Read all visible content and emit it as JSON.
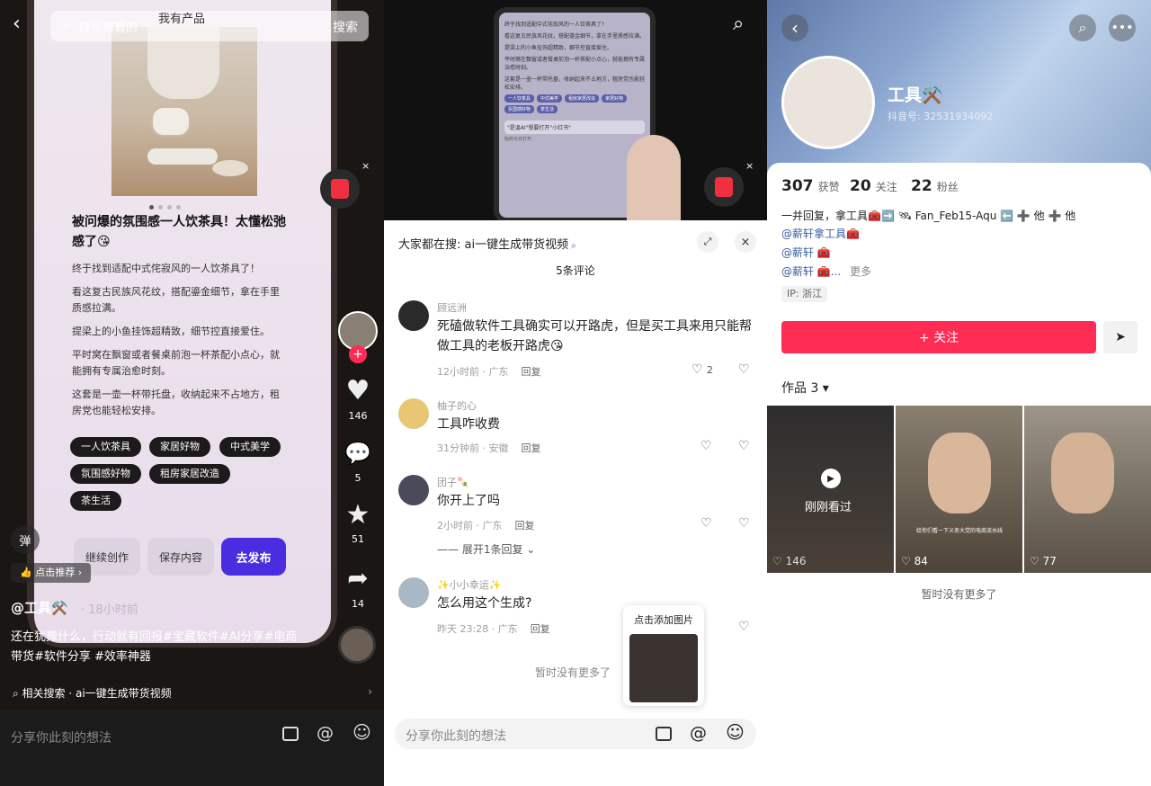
{
  "left": {
    "search_placeholder": "搜你想看的",
    "search_button": "搜索",
    "product_label": "我有产品",
    "post_title": "被问爆的氛围感一人饮茶具！太懂松弛感了😘",
    "paragraphs": [
      "终于找到适配中式侘寂风的一人饮茶具了！",
      "看这复古民族风花纹，搭配鎏金细节，拿在手里质感拉满。",
      "提梁上的小鱼挂饰超精致，细节控直接爱住。",
      "平时窝在飘窗或者餐桌前泡一杯茶配小点心，就能拥有专属治愈时刻。",
      "这套是一壶一杯带托盘，收纳起来不占地方，租房党也能轻松安排。"
    ],
    "tags": [
      "一人饮茶具",
      "家居好物",
      "中式美学",
      "氛围感好物",
      "租房家居改造",
      "茶生活"
    ],
    "btn_continue": "继续创作",
    "btn_save": "保存内容",
    "btn_publish": "去发布",
    "danmu": "弹",
    "recommend": "点击推荐",
    "likes": "146",
    "comments": "5",
    "stars": "51",
    "shares": "14",
    "author": "@工具⚒️",
    "time": "· 18小时前",
    "caption": "还在犹豫什么，行动就有回报#宝藏软件#AI分享#电商带货#软件分享 #效率神器",
    "related": "相关搜索 · ai一键生成带货视频",
    "input_placeholder": "分享你此刻的想法"
  },
  "middle": {
    "search_hint": "大家都在搜: ai一键生成带货视频",
    "comment_count": "5条评论",
    "comments": [
      {
        "user": "顾远洲",
        "text": "死磕做软件工具确实可以开路虎，但是买工具来用只能帮做工具的老板开路虎😘",
        "time": "12小时前 · 广东",
        "reply": "回复",
        "likes": "2"
      },
      {
        "user": "柚子的心",
        "text": "工具咋收费",
        "time": "31分钟前 · 安徽",
        "reply": "回复",
        "likes": ""
      },
      {
        "user": "团子🍡",
        "text": "你开上了吗",
        "time": "2小时前 · 广东",
        "reply": "回复",
        "likes": ""
      },
      {
        "user": "✨小小幸运✨",
        "text": "怎么用这个生成?",
        "time": "昨天 23:28 · 广东",
        "reply": "回复",
        "likes": ""
      }
    ],
    "expand": "展开1条回复",
    "no_more": "暂时没有更多了",
    "add_image": "点击添加图片",
    "input_placeholder": "分享你此刻的想法",
    "phone_text": [
      "终于找到适配中式侘寂风的一人饮茶具了！",
      "看这复古民族风花纹，搭配鎏金细节，拿在手里质感拉满。",
      "提梁上的小鱼挂饰超精致，细节控直接爱住。",
      "平时窝在飘窗或者餐桌前泡一杯茶配小点心，就能拥有专属治愈时刻。",
      "这套是一壶一杯带托盘，收纳起来不占地方，租房党也能轻松安排。"
    ],
    "phone_tags": [
      "一人饮茶具",
      "中式美学",
      "租房家居改造",
      "家居好物",
      "氛围感好物",
      "茶生活"
    ],
    "phone_dialog": "\"是温AI\"想要打开\"小红书\"",
    "phone_allow": "始终允许打开"
  },
  "right": {
    "name": "工具⚒️",
    "douyin_id": "抖音号: 32531934092",
    "stats": [
      {
        "n": "307",
        "l": "获赞"
      },
      {
        "n": "20",
        "l": "关注"
      },
      {
        "n": "22",
        "l": "粉丝"
      }
    ],
    "bio1": "一并回复，拿工具🧰➡️ 🛰 Fan_Feb15-Aqu ⬅️ ➕ 他 ➕ 他",
    "bio2": "@薪轩拿工具🧰",
    "bio3": "@薪轩 🧰",
    "bio4": "@薪轩 🧰...",
    "more": "更多",
    "ip": "IP: 浙江",
    "follow": "+ 关注",
    "works": "作品 3",
    "thumbs": [
      {
        "likes": "146",
        "label": "刚刚看过"
      },
      {
        "likes": "84",
        "caption": "给你们看一下义务大党的电商流水线"
      },
      {
        "likes": "77"
      }
    ],
    "no_more": "暂时没有更多了"
  },
  "colors": {
    "accent": "#fe2c55",
    "publish": "#4a2de0",
    "tag": "#1d1a1c"
  }
}
